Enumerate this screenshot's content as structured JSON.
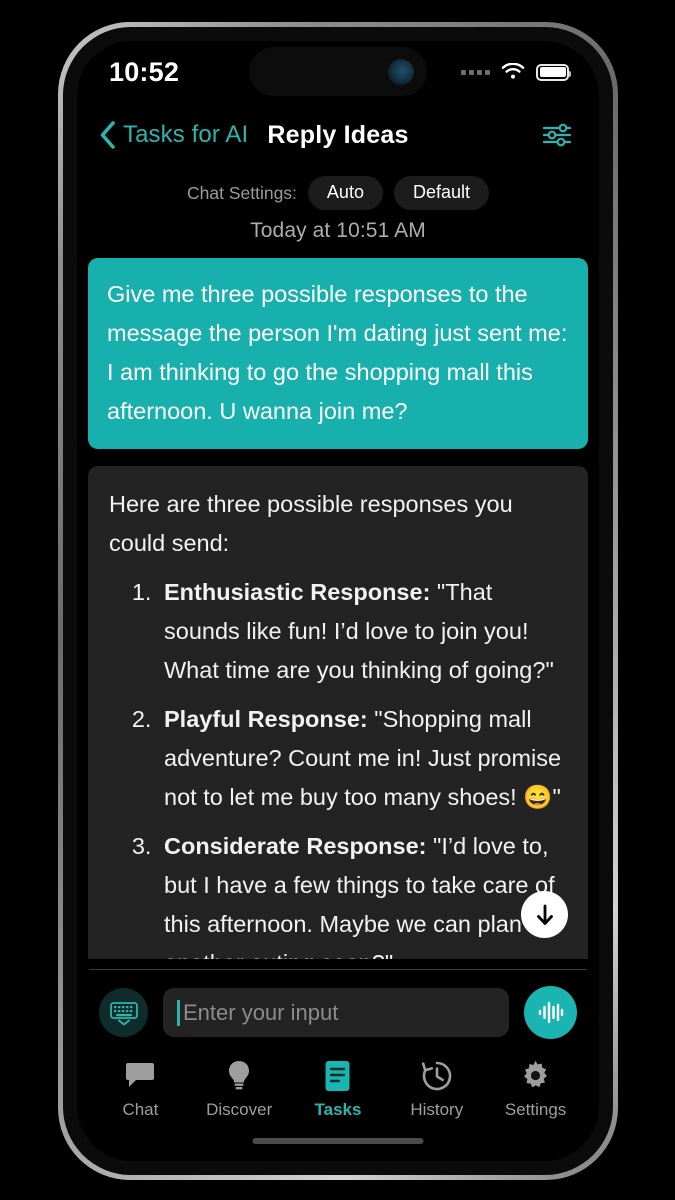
{
  "status_bar": {
    "time": "10:52",
    "cellular_icon": "signal-dots-icon",
    "wifi_icon": "wifi-icon",
    "battery_icon": "battery-full-icon"
  },
  "nav_bar": {
    "back_icon": "chevron-left-icon",
    "back_label": "Tasks for AI",
    "title": "Reply Ideas",
    "settings_icon": "sliders-icon"
  },
  "chat_settings": {
    "label": "Chat Settings:",
    "options": [
      {
        "label": "Auto"
      },
      {
        "label": "Default"
      }
    ]
  },
  "conversation": {
    "timestamp": "Today at 10:51 AM",
    "user_message": "Give me three possible responses to the message the person I'm dating just sent me: I am thinking to go the shopping mall this afternoon. U wanna join me?",
    "assistant_intro": "Here are three possible responses you could send:",
    "assistant_items": [
      {
        "title": "Enthusiastic Response:",
        "body": " \"That sounds like fun! I’d love to join you! What time are you thinking of going?\""
      },
      {
        "title": "Playful Response:",
        "body": " \"Shopping mall adventure? Count me in! Just promise not to let me buy too many shoes! 😄\""
      },
      {
        "title": "Considerate Response:",
        "body": " \"I’d love to, but I have a few things to take care of this afternoon. Maybe we can plan another outing soon?\""
      }
    ],
    "scroll_down_icon": "arrow-down-icon"
  },
  "input_bar": {
    "keyboard_icon": "keyboard-icon",
    "placeholder": "Enter your input",
    "value": "",
    "voice_icon": "waveform-icon"
  },
  "tab_bar": {
    "items": [
      {
        "label": "Chat",
        "icon": "chat-bubble-icon",
        "active": false
      },
      {
        "label": "Discover",
        "icon": "lightbulb-icon",
        "active": false
      },
      {
        "label": "Tasks",
        "icon": "document-lines-icon",
        "active": true
      },
      {
        "label": "History",
        "icon": "clock-rewind-icon",
        "active": false
      },
      {
        "label": "Settings",
        "icon": "gear-icon",
        "active": false
      }
    ]
  },
  "colors": {
    "accent_teal": "#17b0ad",
    "screen_background": "#000000",
    "assistant_bubble": "#232323",
    "inactive_tab": "#9e9e9e"
  }
}
